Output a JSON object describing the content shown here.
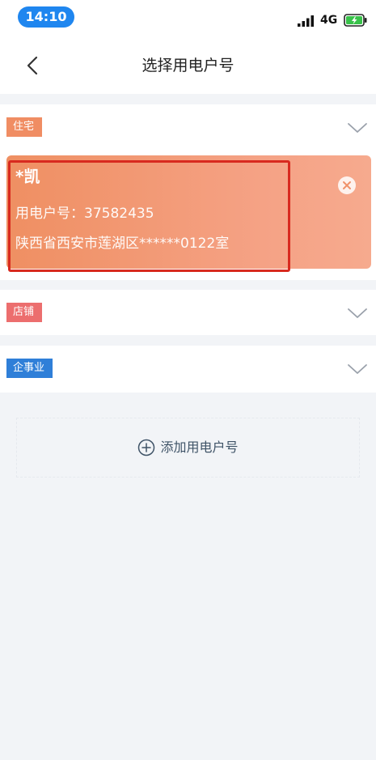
{
  "status_bar": {
    "time": "14:10",
    "network": "4G",
    "signal_icon": "signal-bars-icon",
    "battery_icon": "battery-charging-icon"
  },
  "nav": {
    "title": "选择用电户号",
    "back_icon": "chevron-left-icon"
  },
  "sections": [
    {
      "tag": "住宅",
      "tag_color": "#f08d63"
    },
    {
      "tag": "店铺",
      "tag_color": "#ec6e6e"
    },
    {
      "tag": "企事业",
      "tag_color": "#2f7fd8"
    }
  ],
  "account_card": {
    "name": "*凯",
    "number": "用电户号：37582435",
    "address": "陕西省西安市莲湖区******0122室",
    "remove_icon": "close-circle-icon"
  },
  "add_account": {
    "label": "添加用电户号",
    "icon": "plus-circle-icon"
  },
  "colors": {
    "time_pill": "#1f86ef",
    "highlight": "#d82a1f",
    "card": "#ef8f62"
  }
}
